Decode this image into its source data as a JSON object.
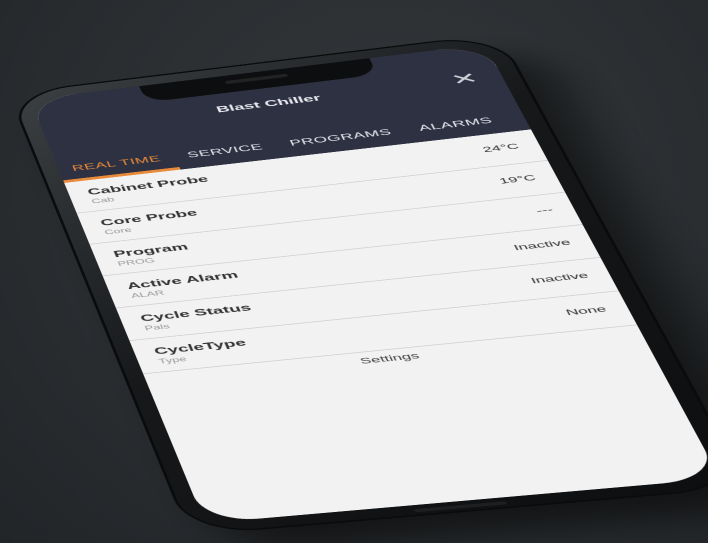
{
  "app": {
    "title": "Blast Chiller",
    "close_icon": "close-icon"
  },
  "tabs": [
    {
      "label": "REAL TIME",
      "active": true
    },
    {
      "label": "SERVICE",
      "active": false
    },
    {
      "label": "PROGRAMS",
      "active": false
    },
    {
      "label": "ALARMS",
      "active": false
    }
  ],
  "rows": [
    {
      "label": "Cabinet Probe",
      "sub": "Cab",
      "value": "24°C"
    },
    {
      "label": "Core Probe",
      "sub": "Core",
      "value": "19°C"
    },
    {
      "label": "Program",
      "sub": "PROG",
      "value": "---"
    },
    {
      "label": "Active Alarm",
      "sub": "ALAR",
      "value": "Inactive"
    },
    {
      "label": "Cycle Status",
      "sub": "Pals",
      "value": "Inactive"
    },
    {
      "label": "CycleType",
      "sub": "Type",
      "value": "None"
    }
  ],
  "settings_label": "Settings",
  "colors": {
    "header_bg": "#2d3142",
    "accent": "#e9893a",
    "screen_bg": "#f2f2f2",
    "background": "#2a2e31"
  }
}
